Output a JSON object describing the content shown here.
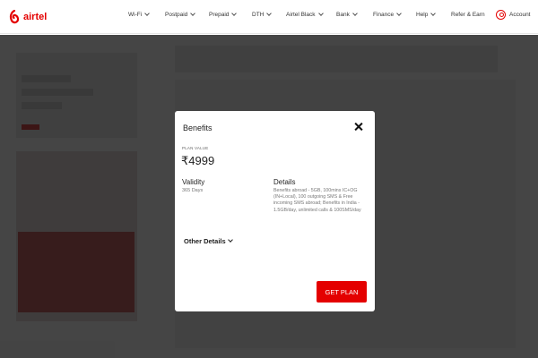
{
  "header": {
    "brand": "airtel",
    "nav": [
      {
        "label": "Wi-Fi"
      },
      {
        "label": "Postpaid"
      },
      {
        "label": "Prepaid"
      },
      {
        "label": "DTH"
      },
      {
        "label": "Airtel Black"
      },
      {
        "label": "Bank"
      },
      {
        "label": "Finance"
      },
      {
        "label": "Help"
      },
      {
        "label": "Refer & Earn"
      }
    ],
    "account_label": "Account"
  },
  "modal": {
    "title": "Benefits",
    "plan_value_label": "PLAN VALUE",
    "plan_value": "₹4999",
    "validity_heading": "Validity",
    "validity_value": "365 Days",
    "details_heading": "Details",
    "details_text": "Benefits abroad - 5GB, 100mins IC+OG (IN+Local), 100 outgoing SMS & Free incoming SMS abroad; Benefits in India - 1.5GB/day, unlimited calls & 100SMS/day",
    "other_details_label": "Other Details",
    "cta_label": "GET PLAN"
  },
  "colors": {
    "brand_red": "#e40000",
    "overlay": "rgba(20,20,20,0.78)"
  }
}
